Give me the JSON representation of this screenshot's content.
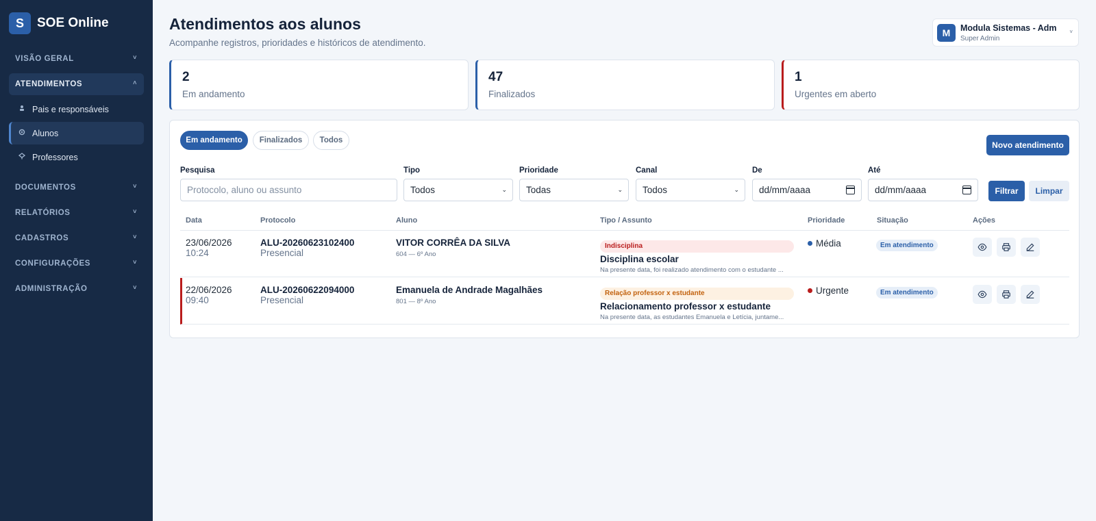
{
  "sidebar": {
    "brand_initial": "S",
    "brand_name": "SOE Online",
    "sections": {
      "visao_geral": "VISÃO GERAL",
      "atendimentos": "ATENDIMENTOS",
      "documentos": "DOCUMENTOS",
      "relatorios": "RELATÓRIOS",
      "cadastros": "CADASTROS",
      "configuracoes": "CONFIGURAÇÕES",
      "administracao": "ADMINISTRAÇÃO"
    },
    "items": {
      "pais": "Pais e responsáveis",
      "alunos": "Alunos",
      "professores": "Professores"
    },
    "chevron": "˅",
    "chevron_open": "˄"
  },
  "header": {
    "title": "Atendimentos aos alunos",
    "subtitle": "Acompanhe registros, prioridades e históricos de atendimento."
  },
  "user": {
    "initial": "M",
    "name": "Modula Sistemas - Adm",
    "role": "Super Admin",
    "chevron": "˅"
  },
  "stats": [
    {
      "value": "2",
      "label": "Em andamento"
    },
    {
      "value": "47",
      "label": "Finalizados"
    },
    {
      "value": "1",
      "label": "Urgentes em aberto"
    }
  ],
  "tabs": [
    "Em andamento",
    "Finalizados",
    "Todos"
  ],
  "new_button": "Novo atendimento",
  "filters": {
    "search_label": "Pesquisa",
    "search_placeholder": "Protocolo, aluno ou assunto",
    "tipo_label": "Tipo",
    "tipo_value": "Todos",
    "prioridade_label": "Prioridade",
    "prioridade_value": "Todas",
    "canal_label": "Canal",
    "canal_value": "Todos",
    "de_label": "De",
    "de_placeholder": "dd/mm/aaaa",
    "ate_label": "Até",
    "ate_placeholder": "dd/mm/aaaa",
    "filter_button": "Filtrar",
    "clear_button": "Limpar",
    "select_chevron": "⌄"
  },
  "table": {
    "headers": [
      "Data",
      "Protocolo",
      "Aluno",
      "Tipo / Assunto",
      "Prioridade",
      "Situação",
      "Ações"
    ],
    "rows": [
      {
        "date": "23/06/2026",
        "time": "10:24",
        "protocol": "ALU-20260623102400",
        "channel": "Presencial",
        "student": "VITOR CORRÊA DA SILVA",
        "class": "604 — 6º Ano",
        "tag": "Indisciplina",
        "subject": "Disciplina escolar",
        "description": "Na presente data, foi realizado atendimento com o estudante ...",
        "priority": "Média",
        "priority_color": "#2b5fa8",
        "status": "Em atendimento"
      },
      {
        "date": "22/06/2026",
        "time": "09:40",
        "protocol": "ALU-20260622094000",
        "channel": "Presencial",
        "student": "Emanuela de Andrade Magalhães",
        "class": "801 — 8º Ano",
        "tag": "Relação professor x estudante",
        "subject": "Relacionamento professor x estudante",
        "description": "Na presente data, as estudantes Emanuela e Letícia, juntame...",
        "priority": "Urgente",
        "priority_color": "#b91c1c",
        "status": "Em atendimento"
      }
    ]
  },
  "colors": {
    "sidebar_bg": "#172a45",
    "accent": "#2b5fa8",
    "urgent": "#b91c1c"
  }
}
